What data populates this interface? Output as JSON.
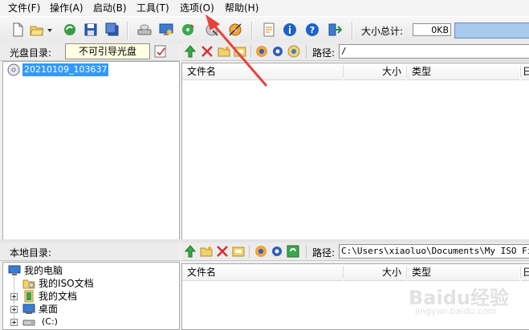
{
  "menu": [
    "文件(F)",
    "操作(A)",
    "启动(B)",
    "工具(T)",
    "选项(O)",
    "帮助(H)"
  ],
  "toolbar": {
    "size_total_label": "大小总计:",
    "size_value": "0KB"
  },
  "disc_panel": {
    "label": "光盘目录:",
    "boot_status": "不可引导光盘",
    "tree_item": "20210109_103637",
    "path_label": "路径:",
    "path_value": "/",
    "columns": [
      "文件名",
      "大小",
      "类型",
      "日"
    ]
  },
  "local_panel": {
    "label": "本地目录:",
    "path_label": "路径:",
    "path_value": "C:\\Users\\xiaoluo\\Documents\\My ISO Files",
    "columns": [
      "文件名",
      "大小",
      "类型",
      "日"
    ],
    "tree": [
      "我的电脑",
      "我的ISO文档",
      "我的文档",
      "桌面",
      "(C:)"
    ]
  },
  "watermark": {
    "brand": "Baidu经验",
    "url": "jingyan.baidu.com"
  },
  "colors": {
    "selection": "#3399ff",
    "capacity_bar": "#a8c8ec",
    "arrow": "#e8433a"
  }
}
